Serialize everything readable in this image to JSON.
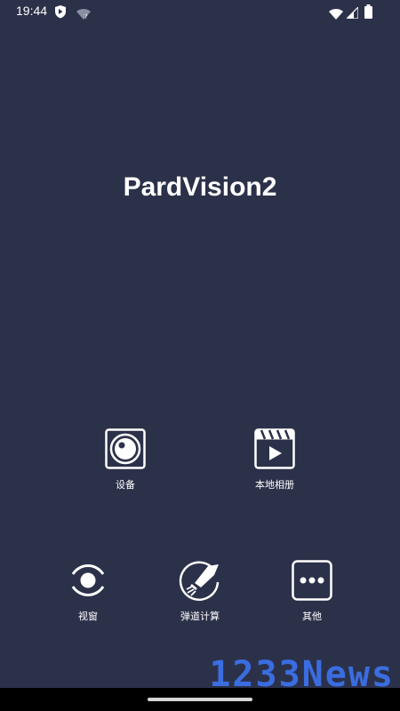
{
  "status_bar": {
    "time": "19:44"
  },
  "app": {
    "title": "PardVision2"
  },
  "menu": {
    "device": "设备",
    "album": "本地相册",
    "view": "视窗",
    "ballistics": "弹道计算",
    "other": "其他"
  },
  "watermark": "1233News",
  "colors": {
    "background": "#2c314a",
    "watermark": "#3a6de0"
  }
}
